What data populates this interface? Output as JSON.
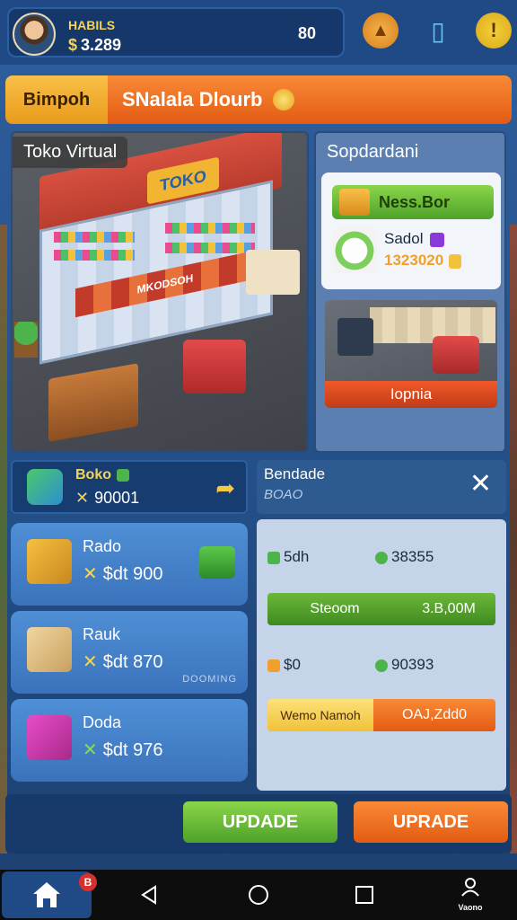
{
  "header": {
    "player_name": "HABILS",
    "currency_symbol": "$",
    "money": "3.289",
    "score": "80"
  },
  "tabs": {
    "tab_left": "Bimpoh",
    "tab_right": "SNalala Dlourb"
  },
  "scene": {
    "label": "Toko Virtual",
    "store_sign": "TOKO",
    "awning_text": "MKODSOH"
  },
  "side_panel": {
    "title": "Sopdardani",
    "offer_button": "Ness.Bor",
    "offer_label": "Sadol",
    "offer_price": "1323020",
    "promo_button": "Iopnia"
  },
  "summary": {
    "title": "Boko",
    "value": "90001"
  },
  "items": [
    {
      "name": "Rado",
      "price": "$dt 900"
    },
    {
      "name": "Rauk",
      "price": "$dt 870",
      "extra": "DOOMING"
    },
    {
      "name": "Doda",
      "price": "$dt 976"
    }
  ],
  "stats": {
    "title": "Bendade",
    "subtitle": "BOAO",
    "row1_left": "5dh",
    "row1_right": "38355",
    "bar1_left": "Steoom",
    "bar1_right": "3.B,00M",
    "row2_left": "$0",
    "row2_right": "90393",
    "bar2_left": "Wemo Namoh",
    "bar2_right": "OAJ,Zdd0"
  },
  "actions": {
    "update": "UPDADE",
    "uprade": "UPRADE"
  },
  "navbar": {
    "badge": "B",
    "profile_label": "Vaono"
  },
  "colors": {
    "primary_blue": "#1f4a86",
    "accent_orange": "#e35b13",
    "accent_green": "#4ea22a",
    "accent_yellow": "#f3d45c"
  }
}
